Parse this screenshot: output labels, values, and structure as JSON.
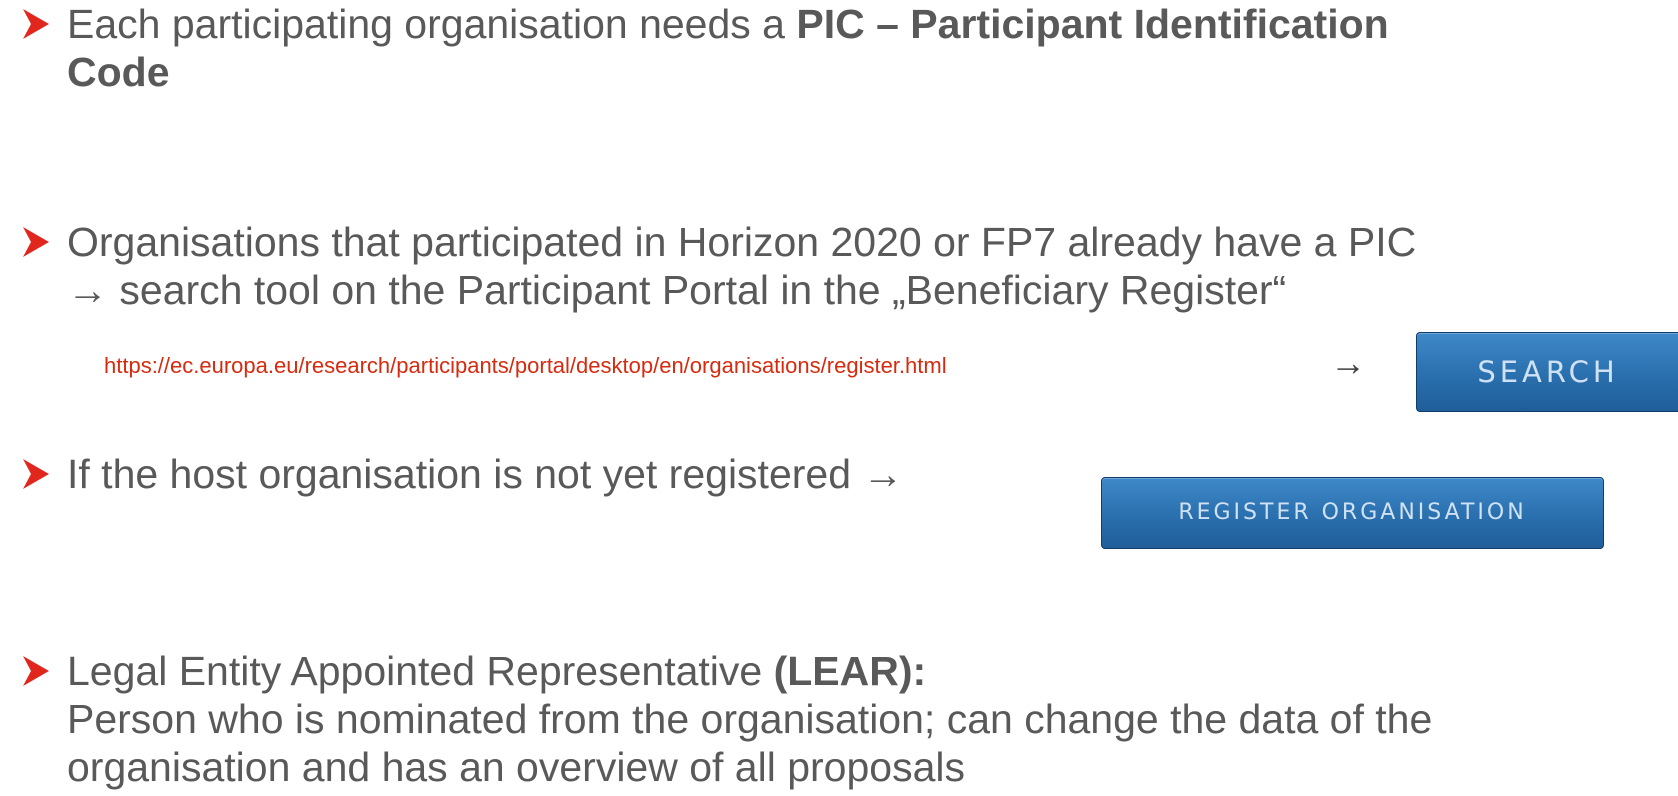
{
  "colors": {
    "bullet_marker": "#e0261d",
    "body_text": "#595959",
    "url_text": "#d62b0f",
    "button_bg": "#2a6fae"
  },
  "bullets": [
    {
      "icon": "arrow-bullet-icon",
      "line1_plain": "Each participating organisation needs a ",
      "line1_bold": "PIC – Participant Identification",
      "line2_bold": "Code"
    },
    {
      "icon": "arrow-bullet-icon",
      "line1": "Organisations that participated in Horizon 2020 or FP7 already have a PIC",
      "line2": "→ search tool on the Participant Portal in the „Beneficiary Register“",
      "url": "https://ec.europa.eu/research/participants/portal/desktop/en/organisations/register.html",
      "url_arrow": "→",
      "button_label": "SEARCH"
    },
    {
      "icon": "arrow-bullet-icon",
      "line1": "If the host organisation is not yet registered →",
      "button_label": "REGISTER ORGANISATION"
    },
    {
      "icon": "arrow-bullet-icon",
      "line1_plain": "Legal Entity Appointed Representative ",
      "line1_bold": "(LEAR):",
      "line2": "Person who is nominated from the organisation; can change the data of the",
      "line3": "organisation and has an overview of all proposals"
    }
  ]
}
